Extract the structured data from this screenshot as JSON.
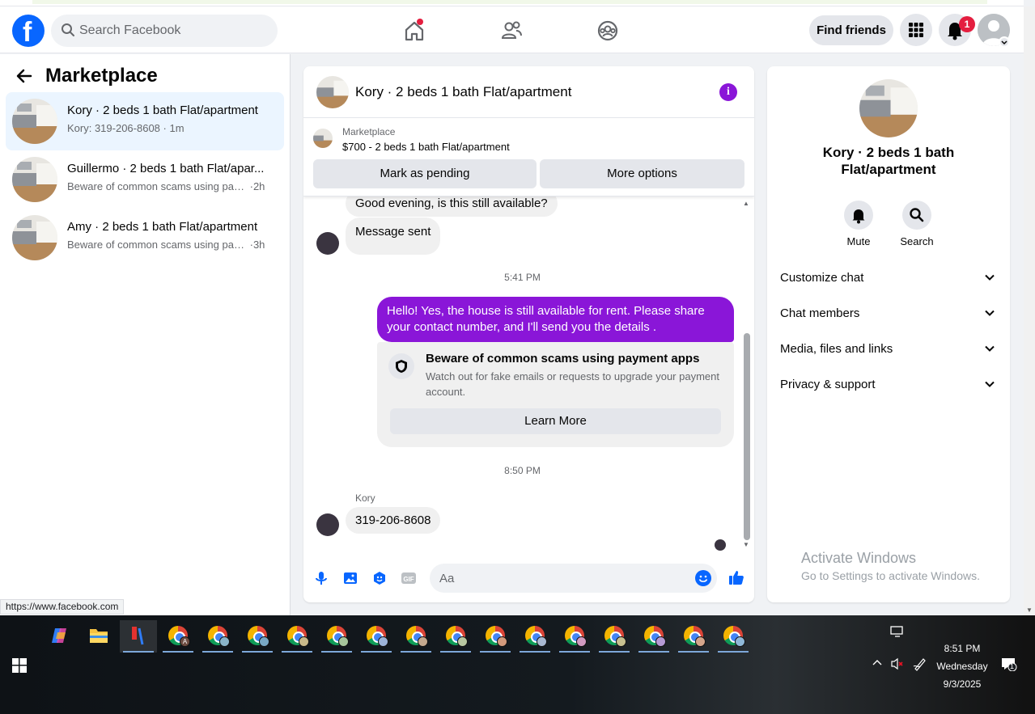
{
  "nav": {
    "search_placeholder": "Search Facebook",
    "find_friends": "Find friends",
    "notification_count": "1"
  },
  "sidebar": {
    "title": "Marketplace",
    "conversations": [
      {
        "name": "Kory · 2 beds 1 bath Flat/apartment",
        "preview": "Kory: 319-206-8608",
        "time": "1m",
        "active": true
      },
      {
        "name": "Guillermo · 2 beds 1 bath Flat/apar...",
        "preview": "Beware of common scams using pay...",
        "time": "2h",
        "active": false
      },
      {
        "name": "Amy · 2 beds 1 bath Flat/apartment",
        "preview": "Beware of common scams using pay...",
        "time": "3h",
        "active": false
      }
    ],
    "status_url": "https://www.facebook.com"
  },
  "chat": {
    "title": "Kory · 2 beds 1 bath Flat/apartment",
    "marketplace_label": "Marketplace",
    "listing": "$700 - 2 beds 1 bath Flat/apartment",
    "mark_pending": "Mark as pending",
    "more_options": "More options",
    "messages": {
      "in_1": "Good evening, is this still available?",
      "in_2": "Message sent",
      "time_1": "5:41 PM",
      "out_1": "Hello! Yes, the house is still available for rent. Please share your contact number, and I'll send you the details .",
      "warning_title": "Beware of common scams using payment apps",
      "warning_desc": "Watch out for fake emails or requests to upgrade your payment account.",
      "learn_more": "Learn More",
      "time_2": "8:50 PM",
      "sender": "Kory",
      "in_3": "319-206-8608"
    },
    "composer_placeholder": "Aa"
  },
  "details": {
    "title": "Kory · 2 beds 1 bath Flat/apartment",
    "mute": "Mute",
    "search": "Search",
    "sections": [
      "Customize chat",
      "Chat members",
      "Media, files and links",
      "Privacy & support"
    ]
  },
  "watermark": {
    "line1": "Activate Windows",
    "line2": "Go to Settings to activate Windows."
  },
  "taskbar": {
    "time": "8:51 PM",
    "day": "Wednesday",
    "date": "9/3/2025",
    "action_center_count": "1"
  },
  "colors": {
    "fb_blue": "#0866ff",
    "accent_purple": "#8a16d8",
    "badge_red": "#e41e3f"
  }
}
